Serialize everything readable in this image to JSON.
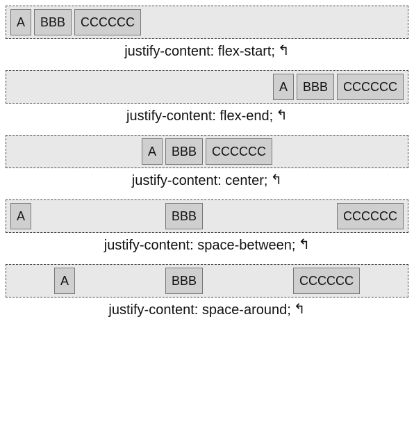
{
  "items": {
    "a": "A",
    "b": "BBB",
    "c": "CCCCCC"
  },
  "arrow_glyph": "↰",
  "examples": [
    {
      "key": "flex-start",
      "caption": "justify-content: flex-start;"
    },
    {
      "key": "flex-end",
      "caption": "justify-content: flex-end;"
    },
    {
      "key": "center",
      "caption": "justify-content: center;"
    },
    {
      "key": "space-between",
      "caption": "justify-content: space-between;"
    },
    {
      "key": "space-around",
      "caption": "justify-content: space-around;"
    }
  ]
}
